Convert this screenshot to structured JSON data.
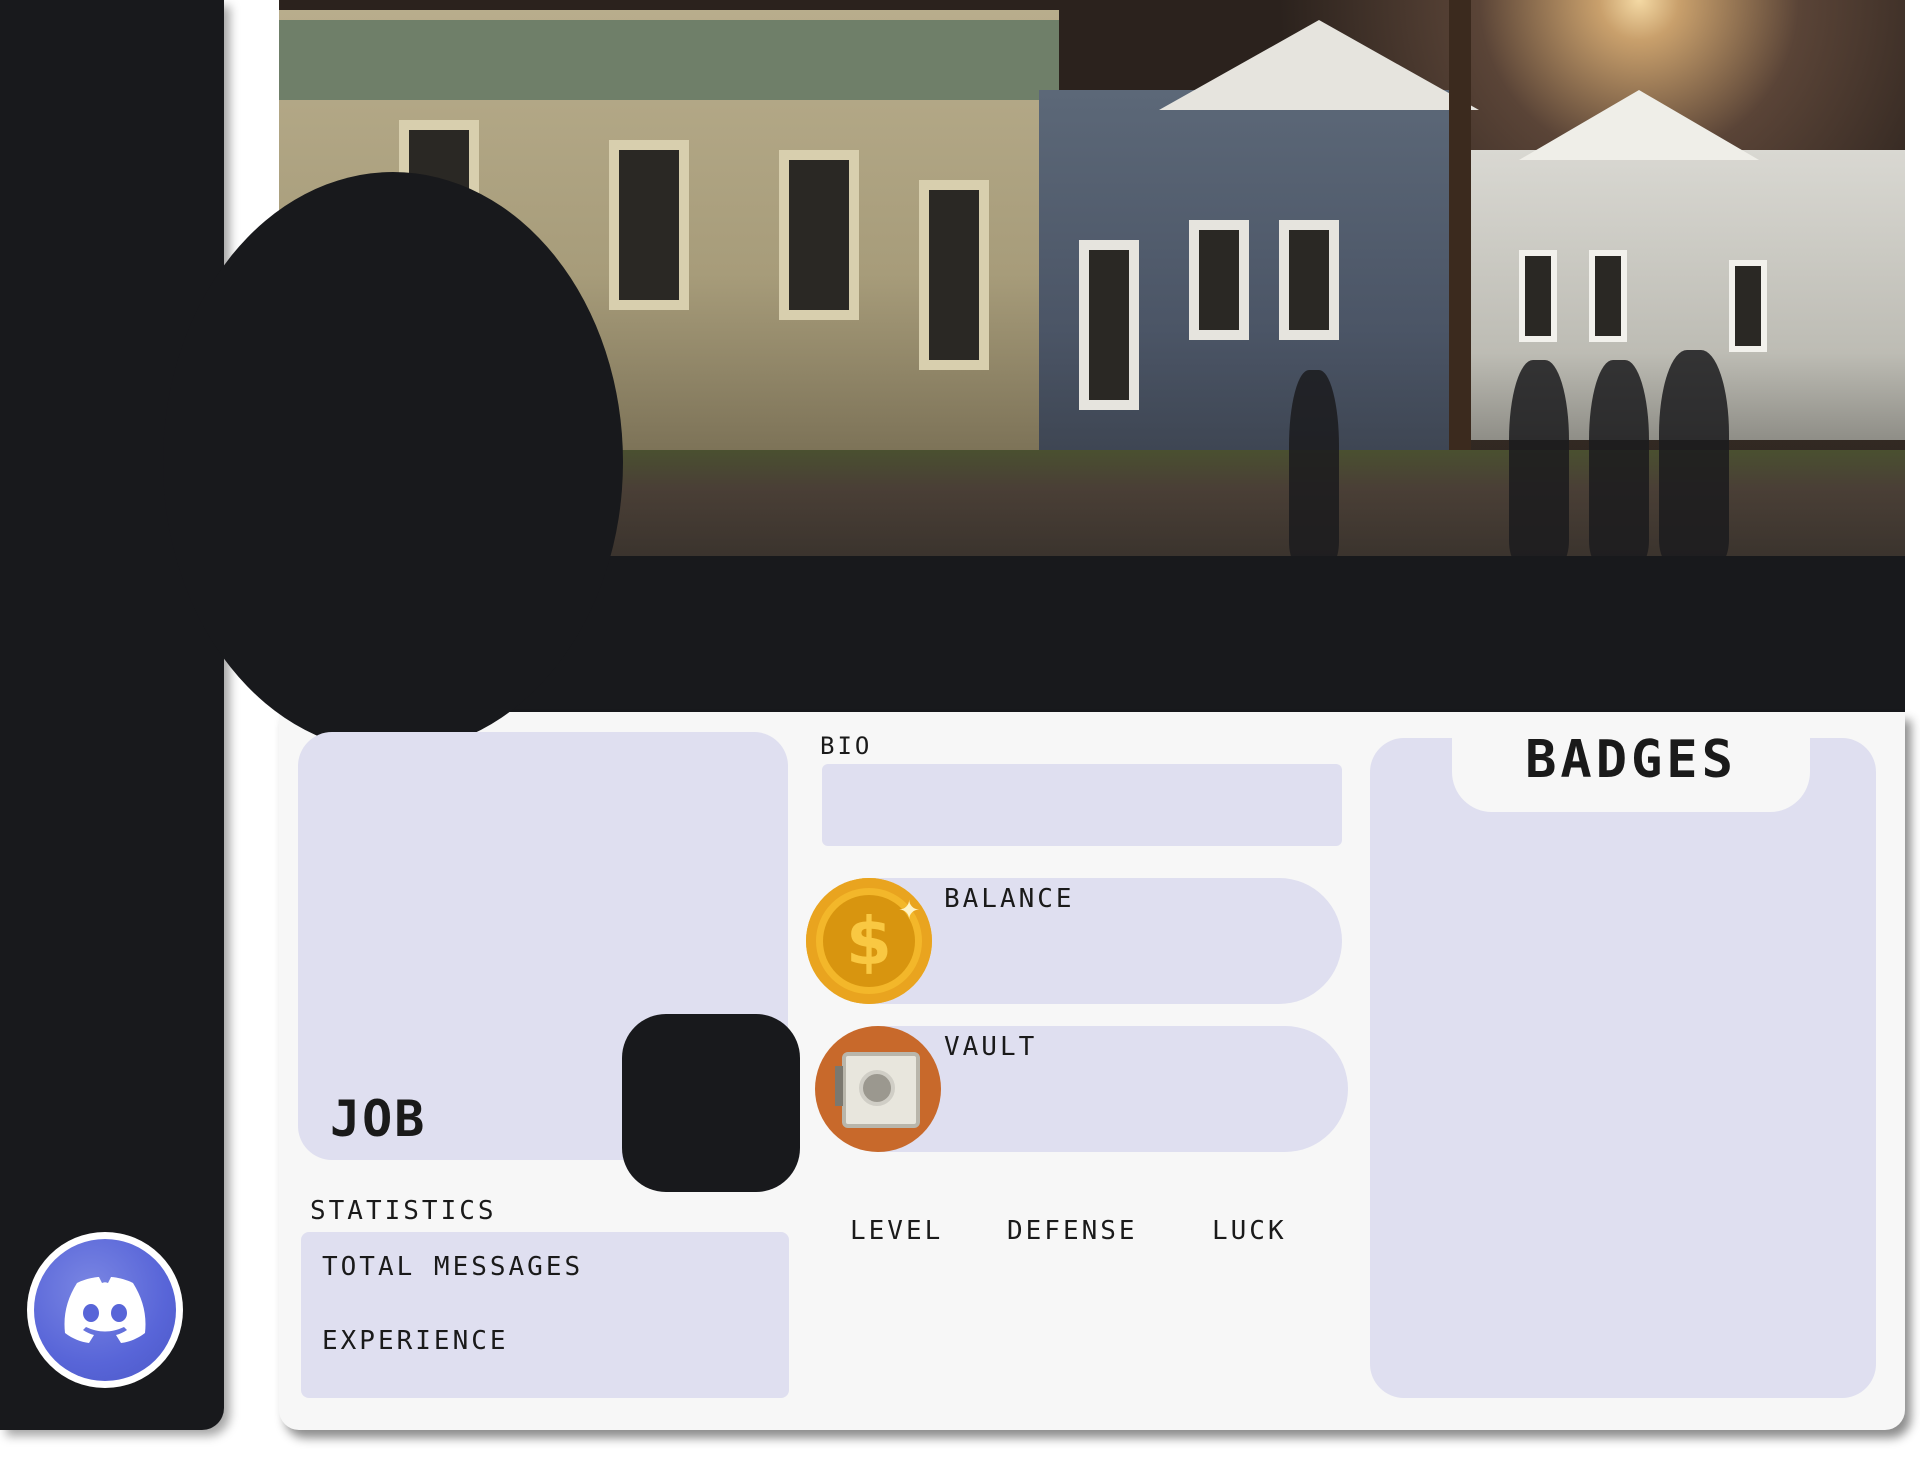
{
  "profile": {
    "job_label": "JOB",
    "bio_label": "BIO",
    "balance_label": "BALANCE",
    "vault_label": "VAULT",
    "stats": {
      "level_label": "LEVEL",
      "defense_label": "DEFENSE",
      "luck_label": "LUCK"
    },
    "statistics": {
      "title": "STATISTICS",
      "total_messages_label": "TOTAL MESSAGES",
      "experience_label": "EXPERIENCE"
    },
    "badges_label": "BADGES"
  },
  "icons": {
    "coin": "dollar-coin-icon",
    "vault": "safe-icon",
    "discord": "discord-logo-icon"
  },
  "colors": {
    "dark": "#18191c",
    "card": "#f7f7f7",
    "panel": "#dfdff0",
    "coin": "#f3b72a",
    "vault": "#c8692b",
    "discord": "#5865d8"
  }
}
